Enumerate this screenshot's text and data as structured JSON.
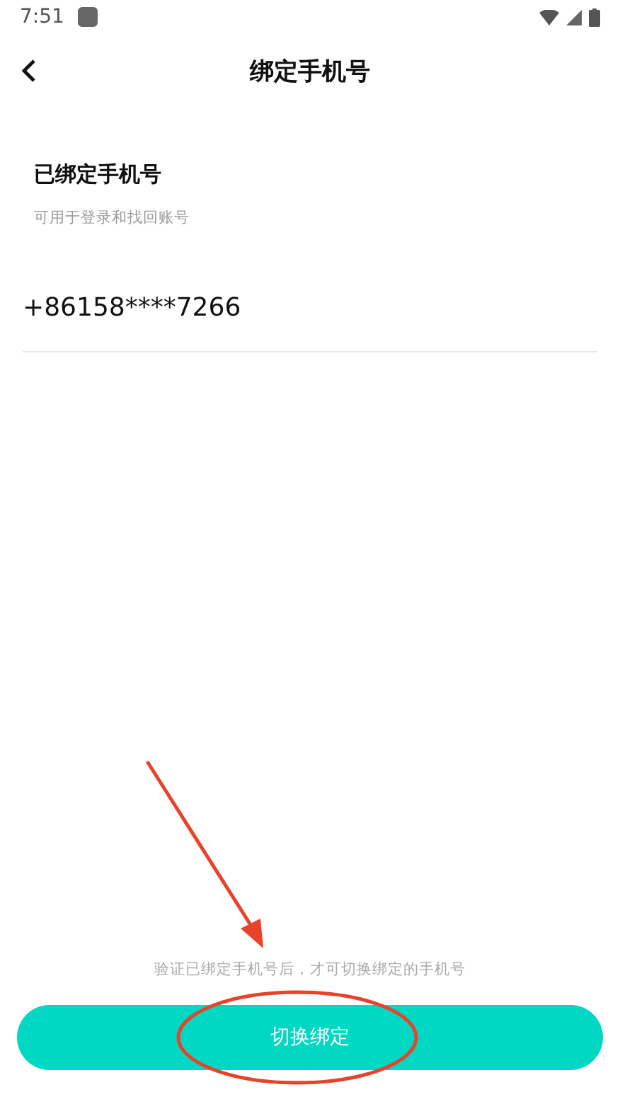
{
  "status_bar": {
    "time": "7:51"
  },
  "header": {
    "title": "绑定手机号"
  },
  "section": {
    "title": "已绑定手机号",
    "subtitle": "可用于登录和找回账号",
    "phone": "+86158****7266"
  },
  "footer": {
    "hint": "验证已绑定手机号后，才可切换绑定的手机号",
    "button": "切换绑定"
  }
}
